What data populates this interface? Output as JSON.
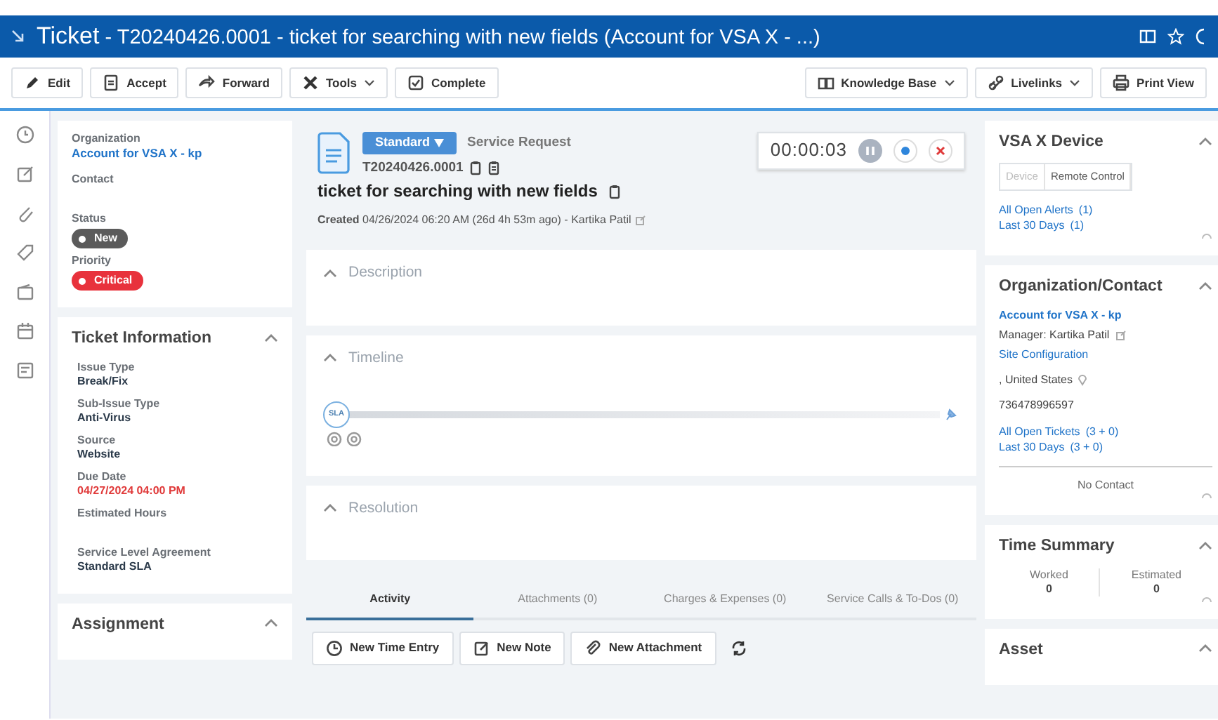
{
  "window": {
    "title_prefix": "Ticket",
    "title": " - T20240426.0001 - ticket for searching with new fields (Account for VSA X - ...)"
  },
  "toolbar": {
    "left": [
      {
        "label": "Edit",
        "dropdown": false
      },
      {
        "label": "Accept",
        "dropdown": false
      },
      {
        "label": "Forward",
        "dropdown": false
      },
      {
        "label": "Tools",
        "dropdown": true
      },
      {
        "label": "Complete",
        "dropdown": false
      }
    ],
    "right": [
      {
        "label": "Knowledge Base",
        "dropdown": true
      },
      {
        "label": "Livelinks",
        "dropdown": true
      },
      {
        "label": "Print View",
        "dropdown": false
      }
    ]
  },
  "summary": {
    "fields": [
      {
        "label": "Organization",
        "value": "Account for VSA X - kp",
        "kind": "link"
      },
      {
        "label": "Contact",
        "kind": "empty"
      },
      {
        "label": "Status",
        "value": "New",
        "kind": "badge",
        "color": "#5b5b5b"
      },
      {
        "label": "Priority",
        "value": "Critical",
        "kind": "badge",
        "color": "#e8323c"
      }
    ]
  },
  "ticket_information": {
    "title": "Ticket Information",
    "expanded": true,
    "fields": [
      {
        "label": "Issue Type",
        "value": "Break/Fix",
        "kind": "text"
      },
      {
        "label": "Sub-Issue Type",
        "value": "Anti-Virus",
        "kind": "text"
      },
      {
        "label": "Source",
        "value": "Website",
        "kind": "text"
      },
      {
        "label": "Due Date",
        "value": "04/27/2024 04:00 PM",
        "kind": "overdue"
      },
      {
        "label": "Estimated Hours",
        "kind": "empty"
      },
      {
        "label": "Service Level Agreement",
        "value": "Standard SLA",
        "kind": "text"
      }
    ]
  },
  "assignment": {
    "title": "Assignment",
    "expanded": true
  },
  "ticket": {
    "type": "Standard",
    "category": "Service Request",
    "number": "T20240426.0001",
    "title": "ticket for searching with new fields",
    "created_label": "Created",
    "created": "04/26/2024 06:20 AM (26d 4h 53m ago) - ",
    "author": "Kartika Patil"
  },
  "timer": {
    "time": "00:00:03"
  },
  "sections": [
    {
      "title": "Description",
      "expanded": true,
      "kind": "text"
    },
    {
      "title": "Timeline",
      "expanded": true,
      "kind": "timeline",
      "sla": "SLA"
    },
    {
      "title": "Resolution",
      "expanded": true,
      "kind": "text"
    }
  ],
  "tabs": [
    {
      "label": "Activity",
      "selected": true
    },
    {
      "label": "Attachments (0)",
      "selected": false
    },
    {
      "label": "Charges & Expenses (0)",
      "selected": false
    },
    {
      "label": "Service Calls & To-Dos (0)",
      "selected": false
    }
  ],
  "activity_buttons": [
    {
      "label": "New Time Entry"
    },
    {
      "label": "New Note"
    },
    {
      "label": "New Attachment"
    }
  ],
  "device": {
    "title": "VSA X Device",
    "expanded": true,
    "tabs": [
      {
        "label": "Device",
        "disabled": true
      },
      {
        "label": "Remote Control",
        "disabled": false
      }
    ],
    "links": [
      {
        "label": "All Open Alerts",
        "count": "(1)"
      },
      {
        "label": "Last 30 Days",
        "count": "(1)"
      }
    ]
  },
  "org_contact": {
    "title": "Organization/Contact",
    "expanded": true,
    "account": "Account for VSA X - kp",
    "manager": "Manager: Kartika Patil",
    "site": "Site Configuration",
    "location": ", United States",
    "phone": "736478996597",
    "links": [
      {
        "label": "All Open Tickets",
        "count": "(3 + 0)"
      },
      {
        "label": "Last 30 Days",
        "count": "(3 + 0)"
      }
    ],
    "contact": "No Contact"
  },
  "time_summary": {
    "title": "Time Summary",
    "expanded": true,
    "items": [
      {
        "label": "Worked",
        "value": "0"
      },
      {
        "label": "Estimated",
        "value": "0"
      }
    ]
  },
  "asset": {
    "title": "Asset",
    "expanded": true
  }
}
